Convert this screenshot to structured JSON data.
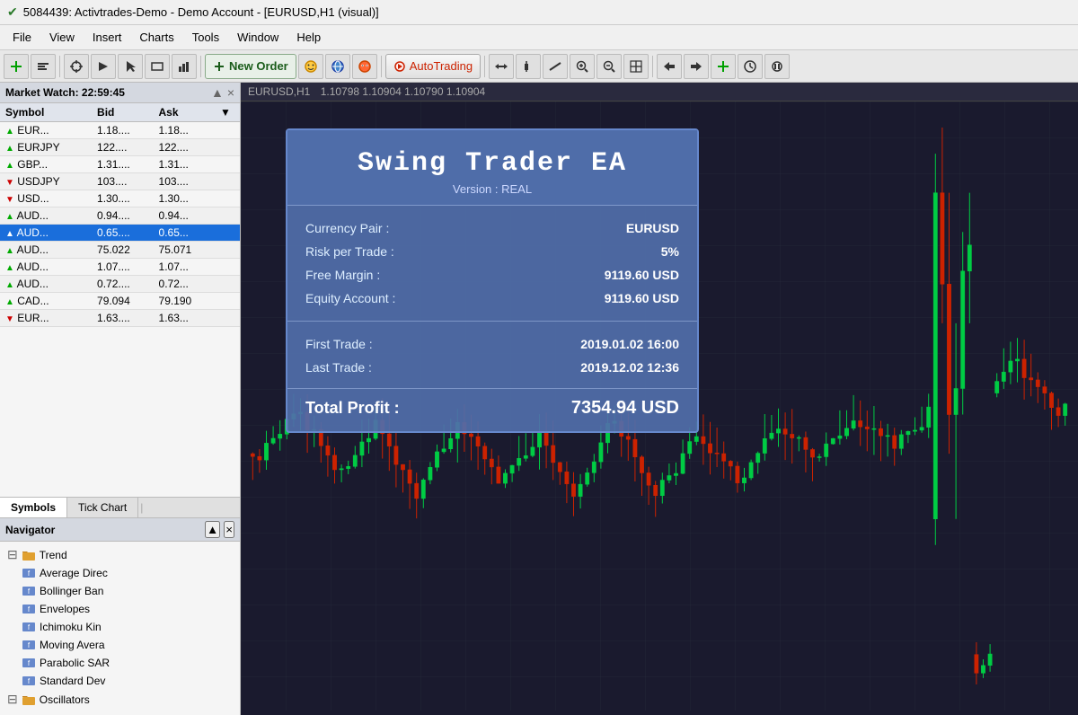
{
  "titleBar": {
    "checkmark": "✔",
    "title": "5084439: Activtrades-Demo - Demo Account - [EURUSD,H1 (visual)]"
  },
  "menuBar": {
    "items": [
      "File",
      "View",
      "Insert",
      "Charts",
      "Tools",
      "Window",
      "Help"
    ]
  },
  "toolbar": {
    "newOrder": "New Order",
    "autoTrading": "AutoTrading"
  },
  "marketWatch": {
    "header": "Market Watch: 22:59:45",
    "columns": [
      "Symbol",
      "Bid",
      "Ask"
    ],
    "rows": [
      {
        "symbol": "EUR...",
        "bid": "1.18....",
        "ask": "1.18...",
        "dir": "up"
      },
      {
        "symbol": "EURJPY",
        "bid": "122....",
        "ask": "122....",
        "dir": "up"
      },
      {
        "symbol": "GBP...",
        "bid": "1.31....",
        "ask": "1.31...",
        "dir": "up"
      },
      {
        "symbol": "USDJPY",
        "bid": "103....",
        "ask": "103....",
        "dir": "down"
      },
      {
        "symbol": "USD...",
        "bid": "1.30....",
        "ask": "1.30...",
        "dir": "down"
      },
      {
        "symbol": "AUD...",
        "bid": "0.94....",
        "ask": "0.94...",
        "dir": "up"
      },
      {
        "symbol": "AUD...",
        "bid": "0.65....",
        "ask": "0.65...",
        "dir": "up",
        "selected": true
      },
      {
        "symbol": "AUD...",
        "bid": "75.022",
        "ask": "75.071",
        "dir": "up"
      },
      {
        "symbol": "AUD...",
        "bid": "1.07....",
        "ask": "1.07...",
        "dir": "up"
      },
      {
        "symbol": "AUD...",
        "bid": "0.72....",
        "ask": "0.72...",
        "dir": "up"
      },
      {
        "symbol": "CAD...",
        "bid": "79.094",
        "ask": "79.190",
        "dir": "up"
      },
      {
        "symbol": "EUR...",
        "bid": "1.63....",
        "ask": "1.63...",
        "dir": "down"
      }
    ],
    "tabs": [
      "Symbols",
      "Tick Chart"
    ],
    "tabSep": "|"
  },
  "navigator": {
    "header": "Navigator",
    "items": [
      {
        "label": "Trend",
        "type": "folder",
        "indent": 0
      },
      {
        "label": "Average Direc",
        "type": "indicator",
        "indent": 1
      },
      {
        "label": "Bollinger Ban",
        "type": "indicator",
        "indent": 1
      },
      {
        "label": "Envelopes",
        "type": "indicator",
        "indent": 1
      },
      {
        "label": "Ichimoku Kin",
        "type": "indicator",
        "indent": 1
      },
      {
        "label": "Moving Avera",
        "type": "indicator",
        "indent": 1
      },
      {
        "label": "Parabolic SAR",
        "type": "indicator",
        "indent": 1
      },
      {
        "label": "Standard Dev",
        "type": "indicator",
        "indent": 1
      }
    ],
    "moreLabel": "Oscillators"
  },
  "chart": {
    "symbol": "EURUSD,H1",
    "ohlc": "1.10798 1.10904 1.10790 1.10904"
  },
  "ea": {
    "title": "Swing Trader EA",
    "version": "Version : REAL",
    "currencyPairLabel": "Currency Pair :",
    "currencyPairValue": "EURUSD",
    "riskLabel": "Risk per Trade :",
    "riskValue": "5%",
    "freeMarginLabel": "Free Margin :",
    "freeMarginValue": "9119.60 USD",
    "equityLabel": "Equity Account :",
    "equityValue": "9119.60 USD",
    "firstTradeLabel": "First Trade :",
    "firstTradeValue": "2019.01.02 16:00",
    "lastTradeLabel": "Last Trade :",
    "lastTradeValue": "2019.12.02 12:36",
    "totalProfitLabel": "Total Profit :",
    "totalProfitValue": "7354.94 USD"
  }
}
